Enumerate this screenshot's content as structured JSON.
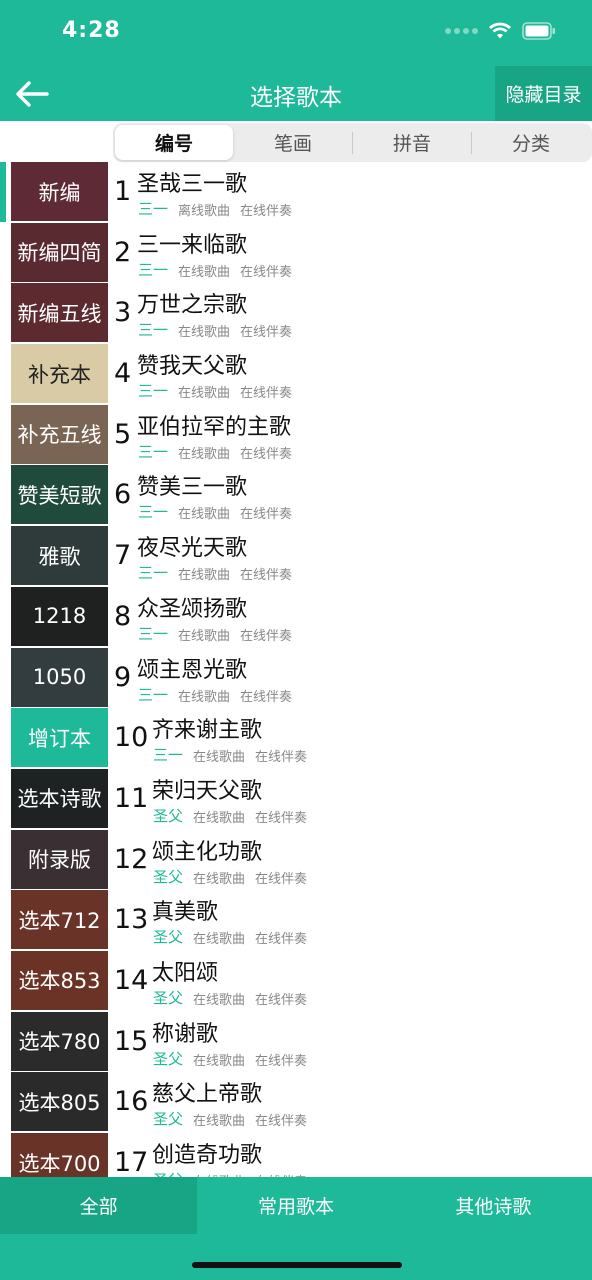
{
  "status": {
    "time": "4:28"
  },
  "nav": {
    "title": "选择歌本",
    "hide_label": "隐藏目录",
    "back_icon": "arrow-left-icon"
  },
  "tabs": [
    {
      "label": "编号",
      "active": true
    },
    {
      "label": "笔画",
      "active": false
    },
    {
      "label": "拼音",
      "active": false
    },
    {
      "label": "分类",
      "active": false
    }
  ],
  "colors": {
    "accent": "#1db998",
    "accent_dark": "#18a585"
  },
  "books": [
    {
      "label": "新编",
      "color": "#5e2a35"
    },
    {
      "label": "新编四简",
      "color": "#5a2a31"
    },
    {
      "label": "新编五线",
      "color": "#5c2a2f"
    },
    {
      "label": "补充本",
      "color": "#d8cba5",
      "text_color": "#222222"
    },
    {
      "label": "补充五线",
      "color": "#7a6555"
    },
    {
      "label": "赞美短歌",
      "color": "#1f4a3c"
    },
    {
      "label": "雅歌",
      "color": "#2f3a3a"
    },
    {
      "label": "1218",
      "color": "#1f2020"
    },
    {
      "label": "1050",
      "color": "#333d40"
    },
    {
      "label": "增订本",
      "color": "#1db998"
    },
    {
      "label": "选本诗歌",
      "color": "#1e2222"
    },
    {
      "label": "附录版",
      "color": "#3a2f33"
    },
    {
      "label": "选本712",
      "color": "#6a3328"
    },
    {
      "label": "选本853",
      "color": "#6b3226"
    },
    {
      "label": "选本780",
      "color": "#2b2b2b"
    },
    {
      "label": "选本805",
      "color": "#2a2a2a"
    },
    {
      "label": "选本700",
      "color": "#6a3327"
    }
  ],
  "songs": [
    {
      "num": "1",
      "title": "圣哉三一歌",
      "category": "三一",
      "tag1": "离线歌曲",
      "tag2": "在线伴奏"
    },
    {
      "num": "2",
      "title": "三一来临歌",
      "category": "三一",
      "tag1": "在线歌曲",
      "tag2": "在线伴奏"
    },
    {
      "num": "3",
      "title": "万世之宗歌",
      "category": "三一",
      "tag1": "在线歌曲",
      "tag2": "在线伴奏"
    },
    {
      "num": "4",
      "title": "赞我天父歌",
      "category": "三一",
      "tag1": "在线歌曲",
      "tag2": "在线伴奏"
    },
    {
      "num": "5",
      "title": "亚伯拉罕的主歌",
      "category": "三一",
      "tag1": "在线歌曲",
      "tag2": "在线伴奏"
    },
    {
      "num": "6",
      "title": "赞美三一歌",
      "category": "三一",
      "tag1": "在线歌曲",
      "tag2": "在线伴奏"
    },
    {
      "num": "7",
      "title": "夜尽光天歌",
      "category": "三一",
      "tag1": "在线歌曲",
      "tag2": "在线伴奏"
    },
    {
      "num": "8",
      "title": "众圣颂扬歌",
      "category": "三一",
      "tag1": "在线歌曲",
      "tag2": "在线伴奏"
    },
    {
      "num": "9",
      "title": "颂主恩光歌",
      "category": "三一",
      "tag1": "在线歌曲",
      "tag2": "在线伴奏"
    },
    {
      "num": "10",
      "title": "齐来谢主歌",
      "category": "三一",
      "tag1": "在线歌曲",
      "tag2": "在线伴奏"
    },
    {
      "num": "11",
      "title": "荣归天父歌",
      "category": "圣父",
      "tag1": "在线歌曲",
      "tag2": "在线伴奏"
    },
    {
      "num": "12",
      "title": "颂主化功歌",
      "category": "圣父",
      "tag1": "在线歌曲",
      "tag2": "在线伴奏"
    },
    {
      "num": "13",
      "title": "真美歌",
      "category": "圣父",
      "tag1": "在线歌曲",
      "tag2": "在线伴奏"
    },
    {
      "num": "14",
      "title": "太阳颂",
      "category": "圣父",
      "tag1": "在线歌曲",
      "tag2": "在线伴奏"
    },
    {
      "num": "15",
      "title": "称谢歌",
      "category": "圣父",
      "tag1": "在线歌曲",
      "tag2": "在线伴奏"
    },
    {
      "num": "16",
      "title": "慈父上帝歌",
      "category": "圣父",
      "tag1": "在线歌曲",
      "tag2": "在线伴奏"
    },
    {
      "num": "17",
      "title": "创造奇功歌",
      "category": "圣父",
      "tag1": "在线歌曲",
      "tag2": "在线伴奏"
    }
  ],
  "bottom_tabs": [
    {
      "label": "全部",
      "active": true
    },
    {
      "label": "常用歌本",
      "active": false
    },
    {
      "label": "其他诗歌",
      "active": false
    }
  ]
}
